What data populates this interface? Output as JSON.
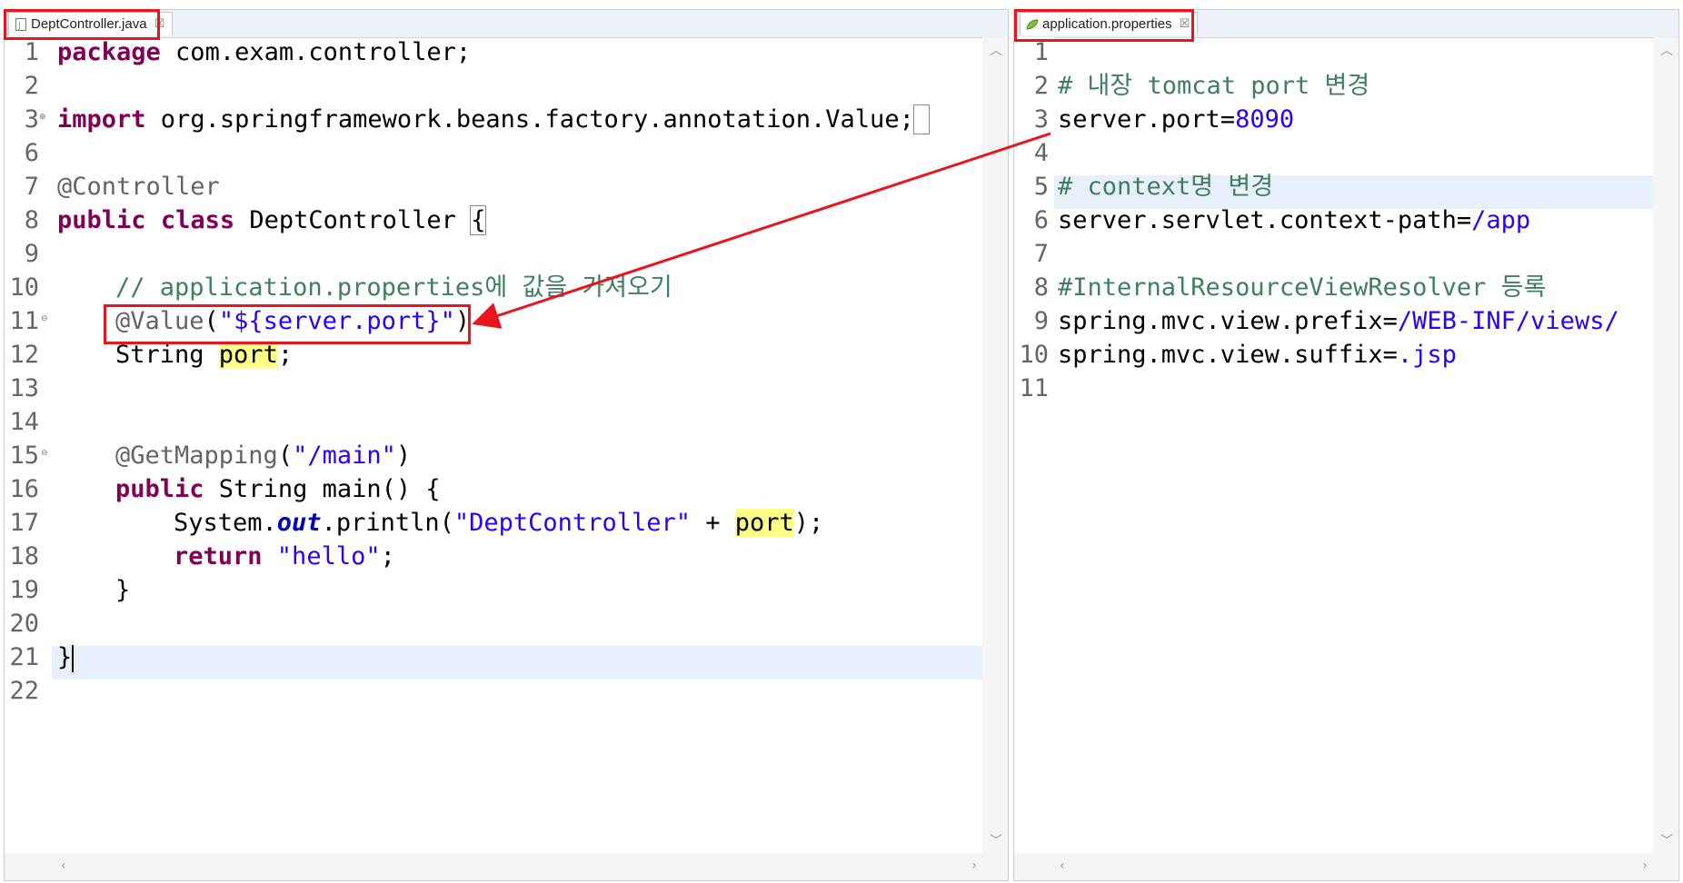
{
  "left_tab": {
    "label": "DeptController.java",
    "close": "☒"
  },
  "right_tab": {
    "label": "application.properties",
    "close": "☒"
  },
  "java": {
    "line_numbers": [
      "1",
      "2",
      "3",
      "6",
      "7",
      "8",
      "9",
      "10",
      "11",
      "12",
      "13",
      "14",
      "15",
      "16",
      "17",
      "18",
      "19",
      "20",
      "21",
      "22"
    ],
    "l1_kw": "package",
    "l1_rest": " com.exam.controller;",
    "l3_kw": "import",
    "l3_rest": " org.springframework.beans.factory.annotation.Value;",
    "l7": "@Controller",
    "l8_kw1": "public",
    "l8_kw2": "class",
    "l8_name": " DeptController ",
    "l8_brace": "{",
    "l10": "// application.properties에 값을 가져오기",
    "l11_ann": "@Value",
    "l11_open": "(",
    "l11_str": "\"${server.port}\"",
    "l11_close": ")",
    "l12_type": "String ",
    "l12_var": "port",
    "l12_end": ";",
    "l15_ann": "@GetMapping",
    "l15_open": "(",
    "l15_str": "\"/main\"",
    "l15_close": ")",
    "l16_kw": "public",
    "l16_rest": " String main() {",
    "l17_a": "System.",
    "l17_field": "out",
    "l17_b": ".println(",
    "l17_str": "\"DeptController\"",
    "l17_c": " + ",
    "l17_var": "port",
    "l17_d": ");",
    "l18_kw": "return",
    "l18_str": " \"hello\"",
    "l18_end": ";",
    "l19": "}",
    "l21": "}"
  },
  "props": {
    "line_numbers": [
      "1",
      "2",
      "3",
      "4",
      "5",
      "6",
      "7",
      "8",
      "9",
      "10",
      "11"
    ],
    "l2": "# 내장 tomcat port 변경",
    "l3_key": "server.port=",
    "l3_val": "8090",
    "l5": "# context명 변경",
    "l6_key": "server.servlet.context-path=",
    "l6_val": "/app",
    "l8": "#InternalResourceViewResolver 등록",
    "l9_key": "spring.mvc.view.prefix=",
    "l9_val": "/WEB-INF/views/",
    "l10_key": "spring.mvc.view.suffix=",
    "l10_val": ".jsp"
  },
  "colors": {
    "annotation_box": "#e8141e",
    "arrow": "#e8141e",
    "keyword": "#7f0055",
    "string": "#2a00ff"
  }
}
